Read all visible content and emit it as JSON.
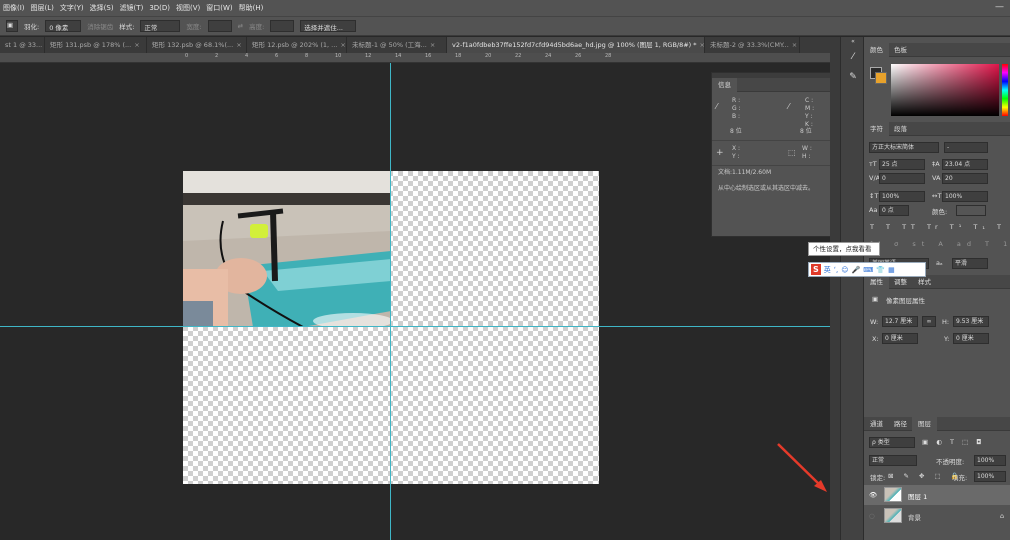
{
  "menu": [
    "图像(I)",
    "图层(L)",
    "文字(Y)",
    "选择(S)",
    "滤镜(T)",
    "3D(D)",
    "视图(V)",
    "窗口(W)",
    "帮助(H)"
  ],
  "options": {
    "feather_label": "羽化:",
    "feather_value": "0 像素",
    "antialias": "消除锯齿",
    "style_label": "样式:",
    "style_value": "正常",
    "width_label": "宽度:",
    "height_label": "高度:",
    "select_mask": "选择并遮住..."
  },
  "tabs": [
    "st 1 @ 33...",
    "矩形 131.psb @ 178% (...",
    "矩形 132.psb @ 68.1%(...",
    "矩形 12.psb @ 202% (1, ...",
    "未标题-1 @ 50% (工海...",
    "v2-f1a0fdbeb37ffe152fd7cfd94d5bd6ae_hd.jpg @ 100% (图层 1, RGB/8#) *",
    "未标题-2 @ 33.3%(CMY..."
  ],
  "ruler_ticks": [
    "0",
    "2",
    "4",
    "6",
    "8",
    "10",
    "12",
    "14",
    "16",
    "18",
    "20",
    "22",
    "24",
    "26",
    "28"
  ],
  "info": {
    "tab": "信息",
    "rgb": "R :\nG :\nB :",
    "bit1": "8 位",
    "cmyk": "C :\nM :\nY :\nK :",
    "bit2": "8 位",
    "xy": "X :\nY :",
    "wh": "W :\nH :",
    "doc": "文档:1.11M/2.60M",
    "hint": "从中心绘制选区或从其选区中减去。"
  },
  "color_panel": {
    "tabs": [
      "颜色",
      "色板"
    ],
    "fg": "#2b2b2b",
    "bg": "#e8a22b"
  },
  "char_panel": {
    "tabs": [
      "字符",
      "段落"
    ],
    "font": "方正大标宋简体",
    "font_style": "-",
    "size": "25 点",
    "leading": "23.04 点",
    "kerning": "0",
    "tracking": "20",
    "vscale": "100%",
    "hscale": "100%",
    "baseline": "0 点",
    "color_label": "颜色:",
    "language": "美国英语",
    "aa": "平滑"
  },
  "props_panel": {
    "tabs": [
      "属性",
      "调整",
      "样式"
    ],
    "title": "像素图层属性",
    "w_label": "W:",
    "w": "12.7 厘米",
    "h_label": "H:",
    "h": "9.53 厘米",
    "x_label": "X:",
    "x": "0 厘米",
    "y_label": "Y:",
    "y": "0 厘米"
  },
  "layers_panel": {
    "tabs": [
      "通道",
      "路径",
      "图层"
    ],
    "kind": "ρ 类型",
    "blend": "正常",
    "opacity_label": "不透明度:",
    "opacity": "100%",
    "lock_label": "锁定:",
    "fill_label": "填充:",
    "fill": "100%",
    "layers": [
      "图层 1",
      "背景"
    ]
  },
  "ime": {
    "tooltip": "个性设置，点我看看",
    "logo": "S",
    "lang": "英"
  }
}
